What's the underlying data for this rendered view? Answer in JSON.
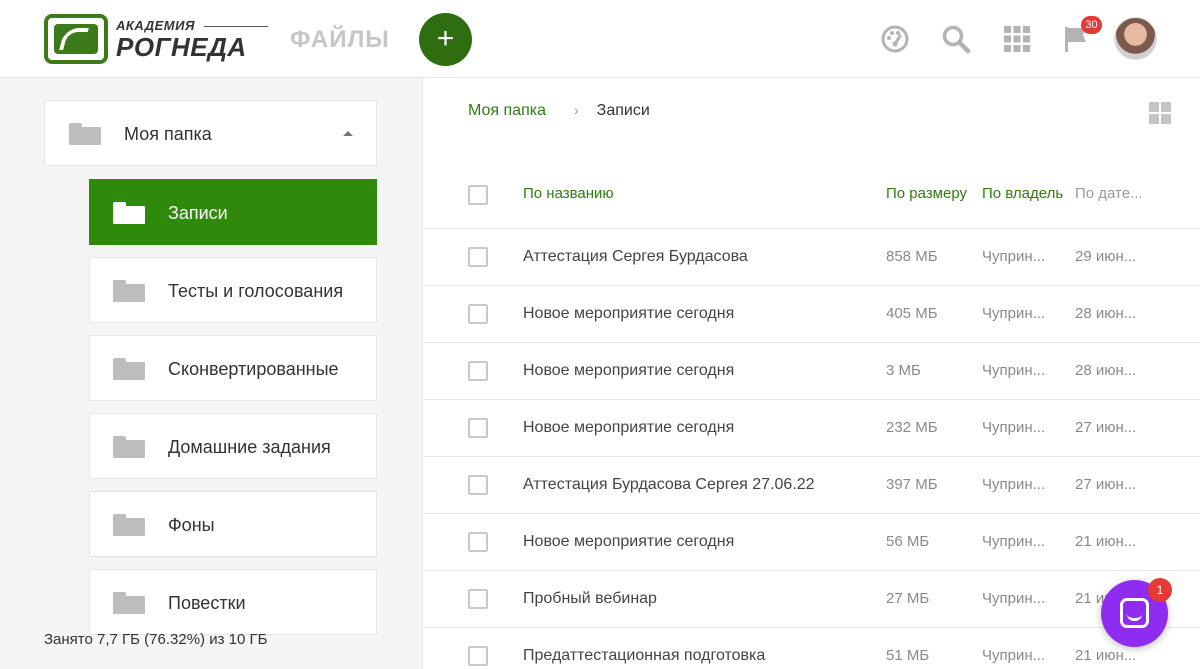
{
  "header": {
    "logo_small": "АКАДЕМИЯ",
    "logo_main": "РОГНЕДА",
    "section_title": "ФАЙЛЫ",
    "add_label": "+",
    "notifications_count": "30",
    "icons": [
      "dashboard-icon",
      "search-icon",
      "apps-grid-icon",
      "flag-icon"
    ]
  },
  "sidebar": {
    "root": {
      "label": "Моя папка"
    },
    "folders": [
      {
        "label": "Записи",
        "active": true
      },
      {
        "label": "Тесты и голосования"
      },
      {
        "label": "Сконвертированные"
      },
      {
        "label": "Домашние задания"
      },
      {
        "label": "Фоны"
      },
      {
        "label": "Повестки"
      }
    ],
    "storage": "Занято 7,7 ГБ (76.32%) из 10 ГБ"
  },
  "main": {
    "breadcrumb": {
      "root": "Моя папка",
      "separator": "›",
      "current": "Записи"
    },
    "columns": {
      "name": "По названию",
      "size": "По размеру",
      "owner": "По владельцу",
      "date": "По дате..."
    },
    "rows": [
      {
        "name": "Аттестация Сергея Бурдасова",
        "size": "858 МБ",
        "owner": "Чуприн...",
        "date": "29 июн..."
      },
      {
        "name": "Новое мероприятие сегодня",
        "size": "405 МБ",
        "owner": "Чуприн...",
        "date": "28 июн..."
      },
      {
        "name": "Новое мероприятие сегодня",
        "size": "3 МБ",
        "owner": "Чуприн...",
        "date": "28 июн..."
      },
      {
        "name": "Новое мероприятие сегодня",
        "size": "232 МБ",
        "owner": "Чуприн...",
        "date": "27 июн..."
      },
      {
        "name": "Аттестация Бурдасова Сергея 27.06.22",
        "size": "397 МБ",
        "owner": "Чуприн...",
        "date": "27 июн..."
      },
      {
        "name": "Новое мероприятие сегодня",
        "size": "56 МБ",
        "owner": "Чуприн...",
        "date": "21 июн..."
      },
      {
        "name": "Пробный вебинар",
        "size": "27 МБ",
        "owner": "Чуприн...",
        "date": "21 июн..."
      },
      {
        "name": "Предаттестационная подготовка",
        "size": "51 МБ",
        "owner": "Чуприн...",
        "date": "21 июн..."
      }
    ]
  },
  "chat": {
    "badge": "1"
  },
  "colors": {
    "brand_green": "#2f8a0b",
    "accent_dark_green": "#2f6e10",
    "link_green": "#2e7d12",
    "chat_purple": "#8e2cf0",
    "badge_red": "#e53935"
  }
}
